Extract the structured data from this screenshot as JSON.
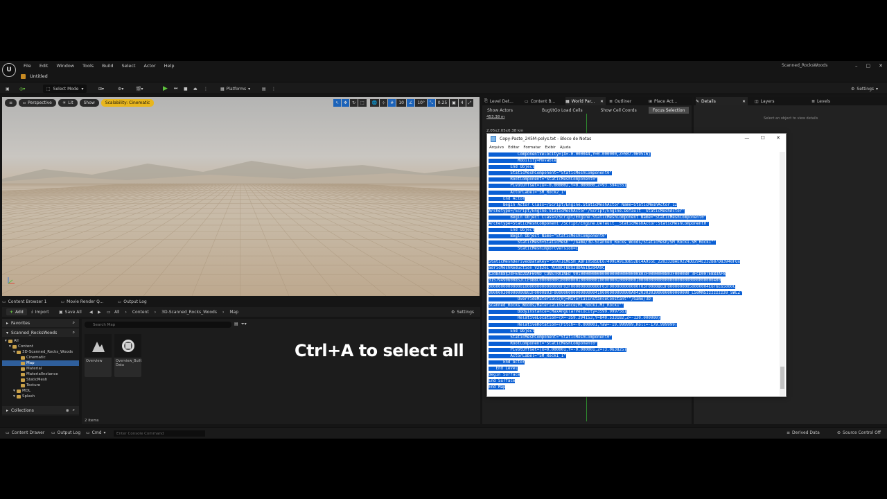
{
  "app": {
    "project_name": "Scanned_RocksWoods",
    "level_tab": "Untitled",
    "menus": [
      "File",
      "Edit",
      "Window",
      "Tools",
      "Build",
      "Select",
      "Actor",
      "Help"
    ],
    "window_controls": [
      "–",
      "▢",
      "✕"
    ]
  },
  "toolbar": {
    "select_mode": "Select Mode",
    "platforms": "Platforms",
    "settings": "Settings"
  },
  "viewport": {
    "perspective": "Perspective",
    "lit": "Lit",
    "show": "Show",
    "scalability": "Scalability: Cinematic",
    "grid_snap": "10",
    "rot_snap": "10°",
    "scale_snap": "0.25",
    "camera_speed": "4"
  },
  "content_browser": {
    "tabs": [
      "Content Browser 1",
      "Movie Render Q...",
      "Output Log"
    ],
    "add": "Add",
    "import": "Import",
    "save_all": "Save All",
    "breadcrumb": [
      "All",
      "Content",
      "3D-Scanned_Rocks_Woods",
      "Map"
    ],
    "settings": "Settings",
    "favorites": "Favorites",
    "project": "Scanned_RocksWoods",
    "tree": [
      {
        "label": "All",
        "depth": 0
      },
      {
        "label": "Content",
        "depth": 1
      },
      {
        "label": "3D-Scanned_Rocks_Woods",
        "depth": 2
      },
      {
        "label": "Cinematic",
        "depth": 3
      },
      {
        "label": "Map",
        "depth": 3,
        "selected": true
      },
      {
        "label": "Material",
        "depth": 3
      },
      {
        "label": "MaterialInstance",
        "depth": 3
      },
      {
        "label": "StaticMesh",
        "depth": 3
      },
      {
        "label": "Texture",
        "depth": 3
      },
      {
        "label": "MDL",
        "depth": 2
      },
      {
        "label": "Splash",
        "depth": 2
      }
    ],
    "collections": "Collections",
    "search_placeholder": "Search Map",
    "assets": [
      {
        "label": "Overview"
      },
      {
        "label": "Overview_Built Data"
      }
    ],
    "item_count": "2 items"
  },
  "overlay_caption": "Ctrl+A to select all",
  "right_panel": {
    "tabs": [
      "Level Det...",
      "Content B...",
      "World Par...",
      "Outliner",
      "Place Act..."
    ],
    "world_partition_buttons": [
      "Show Actors",
      "Bug\\ltGo Load Cells",
      "Show Cell Coords",
      "Focus Selection"
    ],
    "scale_text": "453.38 m",
    "size_text": "2.05x2.05x0.38 km"
  },
  "details_panel": {
    "tabs": [
      "Details",
      "Layers",
      "Levels"
    ],
    "hint": "Select an object to view details"
  },
  "statusbar": {
    "content_drawer": "Content Drawer",
    "output_log": "Output Log",
    "cmd": "Cmd",
    "console_placeholder": "Enter Console Command",
    "derived_data": "Derived Data",
    "source_control": "Source Control Off"
  },
  "notepad": {
    "title": "Copy-Paste_245M-polys.txt - Bloco de Notas",
    "menus": [
      "Arquivo",
      "Editar",
      "Formatar",
      "Exibir",
      "Ajuda"
    ],
    "lines": [
      "            ComponentVelocity=(X=-0.000044,Y=0.000000,Z=507.069516)",
      "            Mobility=Movable",
      "         End Object",
      "         StaticMeshComponent=\"StaticMeshComponent0\"",
      "         RootComponent=\"StaticMeshComponent0\"",
      "         PivotOffset=(X=-0.000002,Y=0.000000,Z=93.594155)",
      "         ActorLabel=\"SM_Rock2_1\"",
      "      End Actor",
      "      Begin Actor Class=/Script/Engine.StaticMeshActor Name=StaticMeshActor_12",
      "Archetype=/Script/Engine.StaticMeshActor'/Script/Engine.Default__StaticMeshActor'",
      "         Begin Object Class=/Script/Engine.StaticMeshComponent Name=\"StaticMeshComponent0\"",
      "Archetype=StaticMeshComponent'/Script/Engine.Default__StaticMeshActor:StaticMeshComponent0'",
      "         End Object",
      "         Begin Object Name=\"StaticMeshComponent0\"",
      "            StaticMesh=StaticMesh'\"/Game/3D-Scanned_Rocks_Woods/StaticMesh/SM_Rock1.SM_Rock1\"'",
      "            StaticMeshImportVersion=1",
      "",
      "StaticMeshDerivedDataKey=\"STATICMESH_ABF10585DE67499EA913B652DC4A955E_228332BAE0224DD294E232B87D83948FQu",
      "adricMeshReduction_V2$2e1_ACB8CFBD$2dDA61$2d4A9C",
      "$2d8488$2dF64D2DAF699D_CONSTRAINED_901000000000000000000000000803F0000000803F000080 3FCD007EB83AF8",
      "31579490600852CCE9BBC000000001000000010000000100000001000000010000000000000000000000000000000400",
      "000000000000001000000000000000F03F000000000000F03F000000000000F03F0000803F00000000050000004E6F6E65000C",
      "000000300000000803F0000803F00000000000000000410000000000000A04203030300000000000000_LS0MNSzzzzzzzz0_SWLZ\"",
      "            OverrideMaterials(0)=MaterialInstanceConstant'\"/Game/3D-",
      "Scanned_Rocks_Woods/MaterialInstance/MI_Rock1.MI_Rock1\"'",
      "            BodyInstance=(MaxAngularVelocity=3599.999756)",
      "            RelativeLocation=(X=-359.294153,Y=840.533182,Z=-130.000000)",
      "            RelativeRotation=(Pitch=-0.000001,Yaw=-19.999999,Roll=-179.999999)",
      "         End Object",
      "         StaticMeshComponent=\"StaticMeshComponent0\"",
      "         RootComponent=\"StaticMeshComponent0\"",
      "         PivotOffset=(X=0.000001,Y=-0.000001,Z=73.063825)",
      "         ActorLabel=\"SM_Rock1_1\"",
      "      End Actor",
      "   End Level",
      "Begin Surface",
      "End Surface",
      "End Map"
    ]
  },
  "colors": {
    "selection": "#0a5fd4",
    "accent_yellow": "#e8b61d",
    "play_green": "#5fc43e",
    "wp_line": "#2e8a2e"
  }
}
